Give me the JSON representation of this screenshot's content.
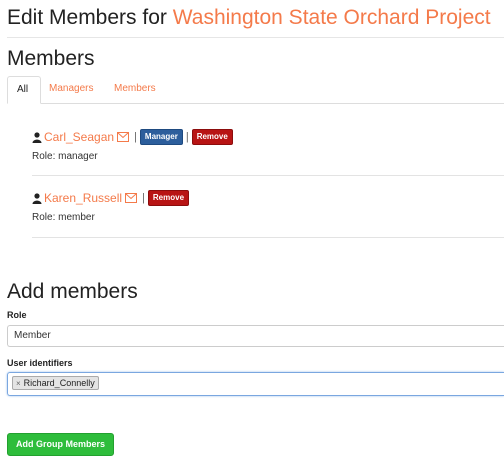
{
  "header": {
    "prefix": "Edit Members for",
    "project": "Washington State Orchard Project"
  },
  "members_section": {
    "title": "Members",
    "tabs": [
      {
        "label": "All",
        "active": true
      },
      {
        "label": "Managers",
        "active": false
      },
      {
        "label": "Members",
        "active": false
      }
    ],
    "list": [
      {
        "name": "Carl_Seagan",
        "role_text": "Role: manager",
        "manager_badge": "Manager",
        "remove_label": "Remove"
      },
      {
        "name": "Karen_Russell",
        "role_text": "Role: member",
        "remove_label": "Remove"
      }
    ]
  },
  "add_section": {
    "title": "Add members",
    "role_label": "Role",
    "role_value": "Member",
    "identifiers_label": "User identifiers",
    "token": "Richard_Connelly",
    "token_remove": "×",
    "submit_label": "Add Group Members"
  },
  "colors": {
    "accent": "#f47a4a",
    "manager_badge": "#2c5e9c",
    "remove_badge": "#b81414",
    "submit_button": "#2ebd3b"
  },
  "icons": [
    "user-icon",
    "envelope-icon"
  ]
}
